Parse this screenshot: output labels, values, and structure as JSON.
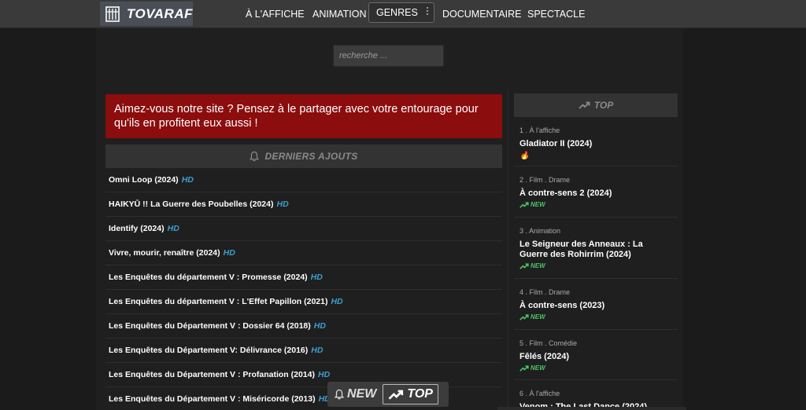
{
  "brand": {
    "name": "TOVARAF",
    "logo_icon": "film-tower-icon"
  },
  "nav": {
    "items": [
      "À L'AFFICHE",
      "ANIMATION"
    ],
    "genres": "GENRES",
    "items_right": [
      "DOCUMENTAIRE",
      "SPECTACLE"
    ]
  },
  "search": {
    "placeholder": "recherche ..."
  },
  "banner": {
    "text": "Aimez-vous notre site ? Pensez à le partager avec votre entourage pour qu'ils en profitent eux aussi !"
  },
  "latest": {
    "title": "DERNIERS AJOUTS",
    "icon": "bell-icon",
    "items": [
      {
        "title": "Omni Loop (2024)",
        "badge": "HD"
      },
      {
        "title": "HAIKYŪ !! La Guerre des Poubelles (2024)",
        "badge": "HD"
      },
      {
        "title": "Identify (2024)",
        "badge": "HD"
      },
      {
        "title": "Vivre, mourir, renaître (2024)",
        "badge": "HD"
      },
      {
        "title": "Les Enquêtes du département V : Promesse (2024)",
        "badge": "HD"
      },
      {
        "title": "Les Enquêtes du département V : L'Effet Papillon (2021)",
        "badge": "HD"
      },
      {
        "title": "Les Enquêtes du Département V : Dossier 64 (2018)",
        "badge": "HD"
      },
      {
        "title": "Les Enquêtes du Département V: Délivrance (2016)",
        "badge": "HD"
      },
      {
        "title": "Les Enquêtes du Département V : Profanation (2014)",
        "badge": "HD"
      },
      {
        "title": "Les Enquêtes du Département V : Miséricorde (2013)",
        "badge": "HD"
      }
    ]
  },
  "top": {
    "title": "TOP",
    "icon": "trending-up-icon",
    "items": [
      {
        "category": "1 . À l'affiche",
        "title": "Gladiator II (2024)",
        "badge": "",
        "badge_icon": "fire-icon"
      },
      {
        "category": "2 . Film . Drame",
        "title": "À contre-sens 2 (2024)",
        "badge": "NEW",
        "badge_icon": "trending-up-icon"
      },
      {
        "category": "3 . Animation",
        "title": "Le Seigneur des Anneaux : La Guerre des Rohirrim (2024)",
        "badge": "NEW",
        "badge_icon": "trending-up-icon"
      },
      {
        "category": "4 . Film . Drame",
        "title": "À contre-sens (2023)",
        "badge": "NEW",
        "badge_icon": "trending-up-icon"
      },
      {
        "category": "5 . Film . Comédie",
        "title": "Fêlés (2024)",
        "badge": "NEW",
        "badge_icon": "trending-up-icon"
      },
      {
        "category": "6 . À l'affiche",
        "title": "Venom : The Last Dance (2024)",
        "badge": "",
        "badge_icon": ""
      }
    ]
  },
  "floating": {
    "new_label": "NEW",
    "top_label": "TOP"
  },
  "colors": {
    "banner": "#8b0d0d",
    "hd": "#3aa0d0",
    "new": "#4cc46a",
    "background": "#1b1b1b"
  }
}
